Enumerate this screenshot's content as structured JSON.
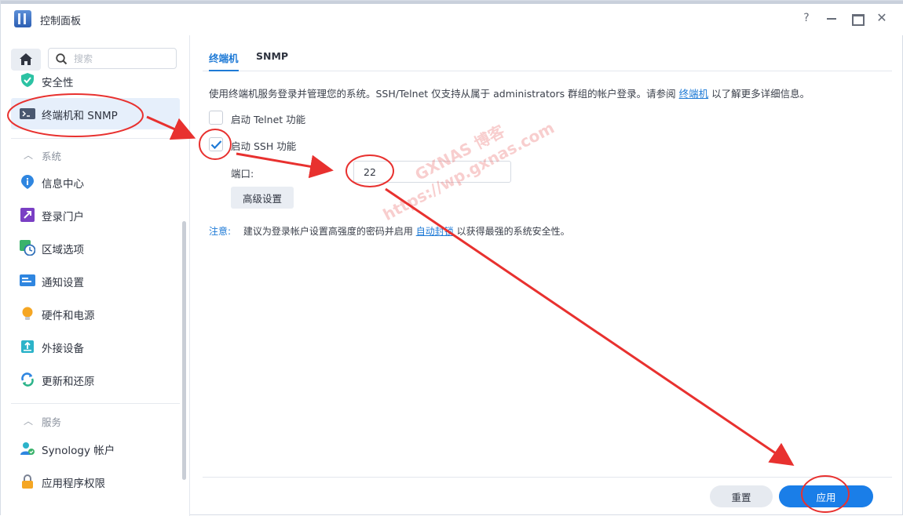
{
  "window": {
    "title": "控制面板"
  },
  "titlebar": {
    "help_label": "?",
    "close_label": "✕"
  },
  "sidebar": {
    "search_placeholder": "搜索",
    "items": [
      {
        "label": "安全性",
        "icon": "shield-icon"
      },
      {
        "label": "终端机和 SNMP",
        "icon": "terminal-icon",
        "active": true
      },
      {
        "label": "信息中心",
        "icon": "info-icon"
      },
      {
        "label": "登录门户",
        "icon": "login-portal-icon"
      },
      {
        "label": "区域选项",
        "icon": "region-icon"
      },
      {
        "label": "通知设置",
        "icon": "notification-icon"
      },
      {
        "label": "硬件和电源",
        "icon": "bulb-icon"
      },
      {
        "label": "外接设备",
        "icon": "external-device-icon"
      },
      {
        "label": "更新和还原",
        "icon": "update-icon"
      },
      {
        "label": "Synology 帐户",
        "icon": "account-icon"
      },
      {
        "label": "应用程序权限",
        "icon": "lock-icon"
      }
    ],
    "sections": {
      "system": "系统",
      "services": "服务"
    }
  },
  "tabs": [
    {
      "label": "终端机",
      "active": true
    },
    {
      "label": "SNMP",
      "active": false
    }
  ],
  "main": {
    "description_prefix": "使用终端机服务登录并管理您的系统。SSH/Telnet 仅支持从属于 administrators 群组的帐户登录。请参阅",
    "description_link": "终端机",
    "description_suffix": "以了解更多详细信息。",
    "telnet_label": "启动 Telnet 功能",
    "telnet_checked": false,
    "ssh_label": "启动 SSH 功能",
    "ssh_checked": true,
    "port_label": "端口:",
    "port_value": "22",
    "advanced_button": "高级设置",
    "note_tag": "注意:",
    "note_prefix": "建议为登录帐户设置高强度的密码并启用",
    "note_link": "自动封锁",
    "note_suffix": "以获得最强的系统安全性。"
  },
  "footer": {
    "reset_label": "重置",
    "apply_label": "应用"
  },
  "watermark": {
    "line1": "GXNAS 博客",
    "line2": "https://wp.gxnas.com"
  },
  "colors": {
    "accent": "#1e7ad6",
    "apply_button": "#1a7ee8",
    "annotation": "#e8312f"
  }
}
